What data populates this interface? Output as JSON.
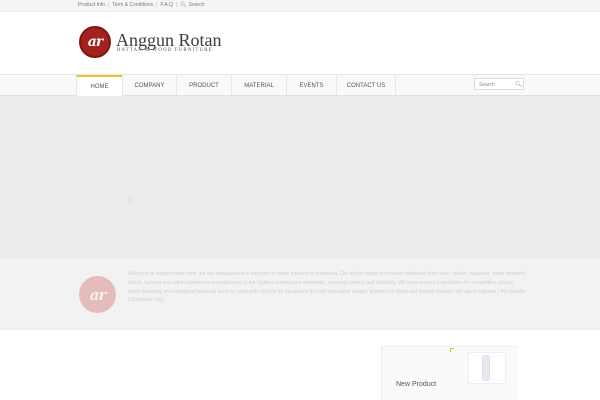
{
  "topbar": {
    "links": [
      "Product Info",
      "Term & Conditions",
      "F.A.Q",
      "Search"
    ],
    "separator": "|",
    "search_icon": "search-icon"
  },
  "brand": {
    "logo_text": "ar",
    "name": "Anggun Rotan",
    "tagline": "RATTAN & WOOD FURNITURE",
    "logo_color": "#a4221d"
  },
  "nav": {
    "items": [
      {
        "label": "HOME",
        "active": true
      },
      {
        "label": "COMPANY",
        "active": false
      },
      {
        "label": "PRODUCT",
        "active": false
      },
      {
        "label": "MATERIAL",
        "active": false
      },
      {
        "label": "EVENTS",
        "active": false
      },
      {
        "label": "CONTACT US",
        "active": false
      }
    ],
    "accent_color": "#e8c32c",
    "search": {
      "placeholder": "Search",
      "icon": "search-icon"
    }
  },
  "welcome": {
    "logo_text": "ar",
    "text": "Welcome to anggun-rotan.com, we are manufacturer & exporter of rattan furniture in Indonesia. Our stylish range of furniture fashioned from cane, wicker, seagrass, water hyacinth, abaca, banana and rattan furniture is manufactured to the highest construction standards, ensuring comfort and durability. We have earned a reputation for competitive pricing whilst providing an exceptional personal service, constantly striving for excellence through innovative design, attention to detail and prompt delivery. We are to importer | Wholesaler | Distributor only."
  },
  "sidebar": {
    "new_product_title": "New Product"
  }
}
